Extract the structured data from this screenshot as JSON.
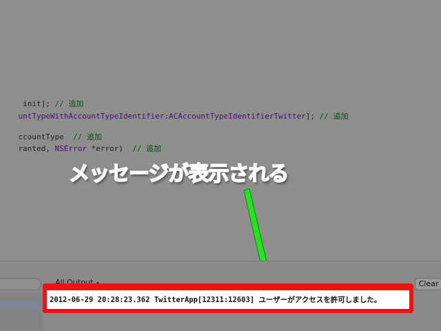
{
  "editor": {
    "line1": {
      "code": " init];",
      "comment": " // 追加"
    },
    "line2": {
      "code": "untTypeWithAccountTypeIdentifier:",
      "constant": "ACAccountTypeIdentifierTwitter",
      "tail": "];",
      "comment": " // 追加"
    },
    "line3": {
      "code": "ccountType",
      "comment": "  // 追加"
    },
    "line4": {
      "code": "ranted, ",
      "type": "NSError",
      "tail": " *error)",
      "comment": "  // 追加"
    }
  },
  "annotation": {
    "callout_text": "メッセージが表示される",
    "callout_color": "#2e8ef5",
    "arrow_color": "#22e61b",
    "highlight_color": "#ee1212"
  },
  "console": {
    "output_selector": "All Output",
    "output_selector_glyph": "▲",
    "clear_label": "Clear",
    "log_text": "2012-06-29 20:28:23.362 TwitterApp[12311:12603] ユーザーがアクセスを許可しました。"
  }
}
